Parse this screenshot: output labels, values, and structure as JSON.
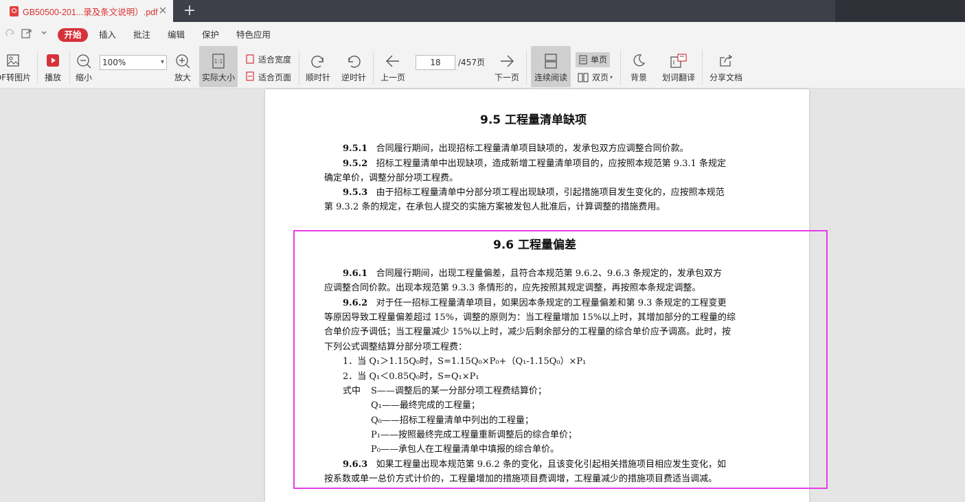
{
  "tab": {
    "title": "GB50500-201...录及条文说明）.pdf"
  },
  "menu": {
    "items": [
      "开始",
      "插入",
      "批注",
      "编辑",
      "保护",
      "特色应用"
    ]
  },
  "toolbar": {
    "pdf_to_image": "DF转图片",
    "play": "播放",
    "zoom_out": "缩小",
    "zoom_value": "100%",
    "zoom_in": "放大",
    "actual_size": "实际大小",
    "fit_width": "适合宽度",
    "fit_page": "适合页面",
    "rotate_cw": "顺时针",
    "rotate_ccw": "逆时针",
    "prev_page": "上一页",
    "page_current": "18",
    "page_total": "/457页",
    "next_page": "下一页",
    "continuous": "连续阅读",
    "single_page": "单页",
    "double_page": "双页",
    "background": "背景",
    "translate": "划词翻译",
    "share": "分享文档"
  },
  "doc": {
    "h95": "9.5 工程量清单缺项",
    "p951_num": "9.5.1",
    "p951": "合同履行期间，出现招标工程量清单项目缺项的，发承包双方应调整合同价款。",
    "p952_num": "9.5.2",
    "p952a": "招标工程量清单中出现缺项，造成新增工程量清单项目的，应按照本规范第 9.3.1 条规定",
    "p952b": "确定单价，调整分部分项工程费。",
    "p953_num": "9.5.3",
    "p953a": "由于招标工程量清单中分部分项工程出现缺项，引起措施项目发生变化的，应按照本规范",
    "p953b": "第 9.3.2 条的规定，在承包人提交的实施方案被发包人批准后，计算调整的措施费用。",
    "h96": "9.6 工程量偏差",
    "p961_num": "9.6.1",
    "p961a": "合同履行期间，出现工程量偏差，且符合本规范第 9.6.2、9.6.3 条规定的，发承包双方",
    "p961b": "应调整合同价款。出现本规范第 9.3.3 条情形的，应先按照其规定调整，再按照本条规定调整。",
    "p962_num": "9.6.2",
    "p962a": "对于任一招标工程量清单项目，如果因本条规定的工程量偏差和第 9.3 条规定的工程变更",
    "p962b": "等原因导致工程量偏差超过 15%，调整的原则为：当工程量增加 15%以上时，其增加部分的工程量的综",
    "p962c": "合单价应予调低；当工程量减少 15%以上时，减少后剩余部分的工程量的综合单价应予调高。此时，按",
    "p962d": "下列公式调整结算分部分项工程费：",
    "f1": "1．当 Q₁＞1.15Q₀时，S=1.15Q₀×P₀+（Q₁-1.15Q₀）×P₁",
    "f2": "2．当 Q₁＜0.85Q₀时，S=Q₁×P₁",
    "where_label": "式中",
    "w1": "S——调整后的某一分部分项工程费结算价；",
    "w2": "Q₁——最终完成的工程量；",
    "w3": "Q₀——招标工程量清单中列出的工程量；",
    "w4": "P₁——按照最终完成工程量重新调整后的综合单价；",
    "w5": "P₀——承包人在工程量清单中填报的综合单价。",
    "p963_num": "9.6.3",
    "p963a": "如果工程量出现本规范第 9.6.2 条的变化，且该变化引起相关措施项目相应发生变化，如",
    "p963b": "按系数或单一总价方式计价的，工程量增加的措施项目费调增，工程量减少的措施项目费适当调减。"
  },
  "colors": {
    "accent": "#d7323c",
    "highlight": "#e63be6",
    "tab_title": "#d9312f"
  }
}
